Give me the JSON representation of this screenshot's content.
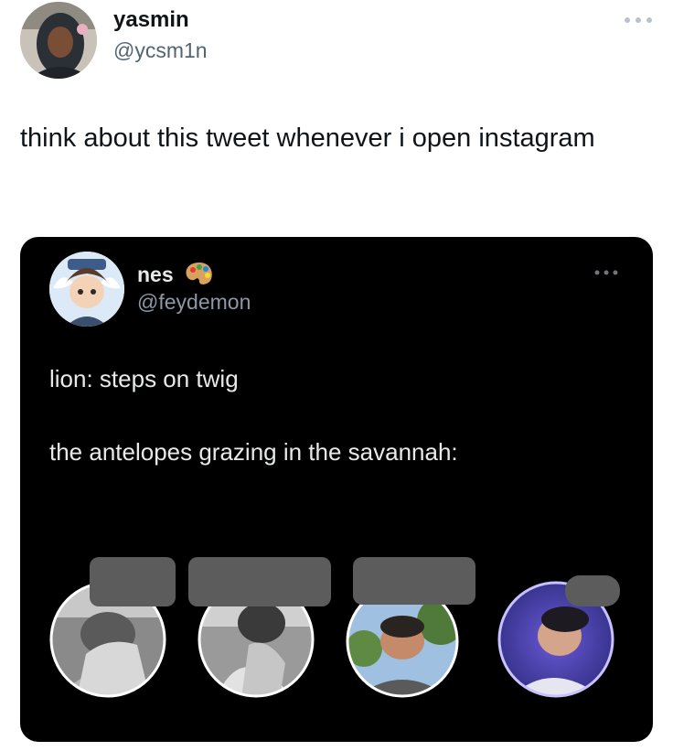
{
  "outer_tweet": {
    "display_name": "yasmin",
    "handle": "@ycsm1n",
    "text": "think about this tweet whenever i open instagram",
    "more_icon": "ellipsis-icon"
  },
  "quoted_tweet": {
    "display_name": "nes",
    "name_emoji_icon": "artist-palette-icon",
    "handle": "@feydemon",
    "line1": "lion: steps on twig",
    "line2": "the antelopes grazing in the savannah:",
    "more_icon": "ellipsis-icon",
    "profile_circles": [
      "profile-photo-1",
      "profile-photo-2",
      "profile-photo-3",
      "profile-photo-4"
    ]
  },
  "colors": {
    "card_bg": "#000000",
    "redaction": "#5c5c5c",
    "text_secondary": "#536471"
  }
}
